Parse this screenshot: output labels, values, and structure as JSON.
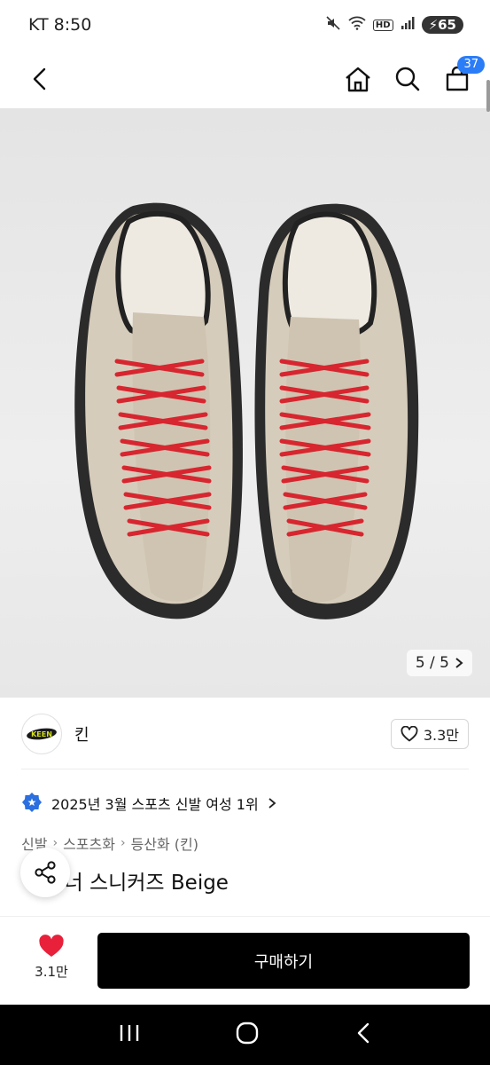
{
  "status_bar": {
    "carrier_time": "KT 8:50",
    "battery_level": "65",
    "icons": [
      "mute-icon",
      "wifi-icon",
      "hd-icon",
      "signal-icon",
      "battery-icon"
    ]
  },
  "top_nav": {
    "back_icon": "chevron-left-icon",
    "home_icon": "home-icon",
    "search_icon": "search-icon",
    "cart_icon": "cart-icon",
    "cart_count": "37"
  },
  "gallery": {
    "counter": "5 / 5",
    "counter_icon": "chevron-right-icon"
  },
  "brand": {
    "logo_text": "KEEN",
    "name": "킨",
    "like_count": "3.3만",
    "like_icon": "heart-outline-icon"
  },
  "ranking": {
    "text": "2025년 3월 스포츠 신발 여성 1위",
    "icon": "medal-icon"
  },
  "breadcrumb": {
    "items": [
      "신발",
      "스포츠화",
      "등산화 (킨)"
    ]
  },
  "product": {
    "title": "재스퍼 스니커즈 Beige",
    "visible_title": "스 너 스니커즈 Beige"
  },
  "bottom_bar": {
    "wish_count": "3.1만",
    "buy_label": "구매하기"
  },
  "colors": {
    "accent_blue": "#2b7cf7",
    "heart_red": "#e8203a",
    "buy_button": "#000000",
    "lace_red": "#d7262f",
    "shoe_beige": "#d8cfbf"
  }
}
